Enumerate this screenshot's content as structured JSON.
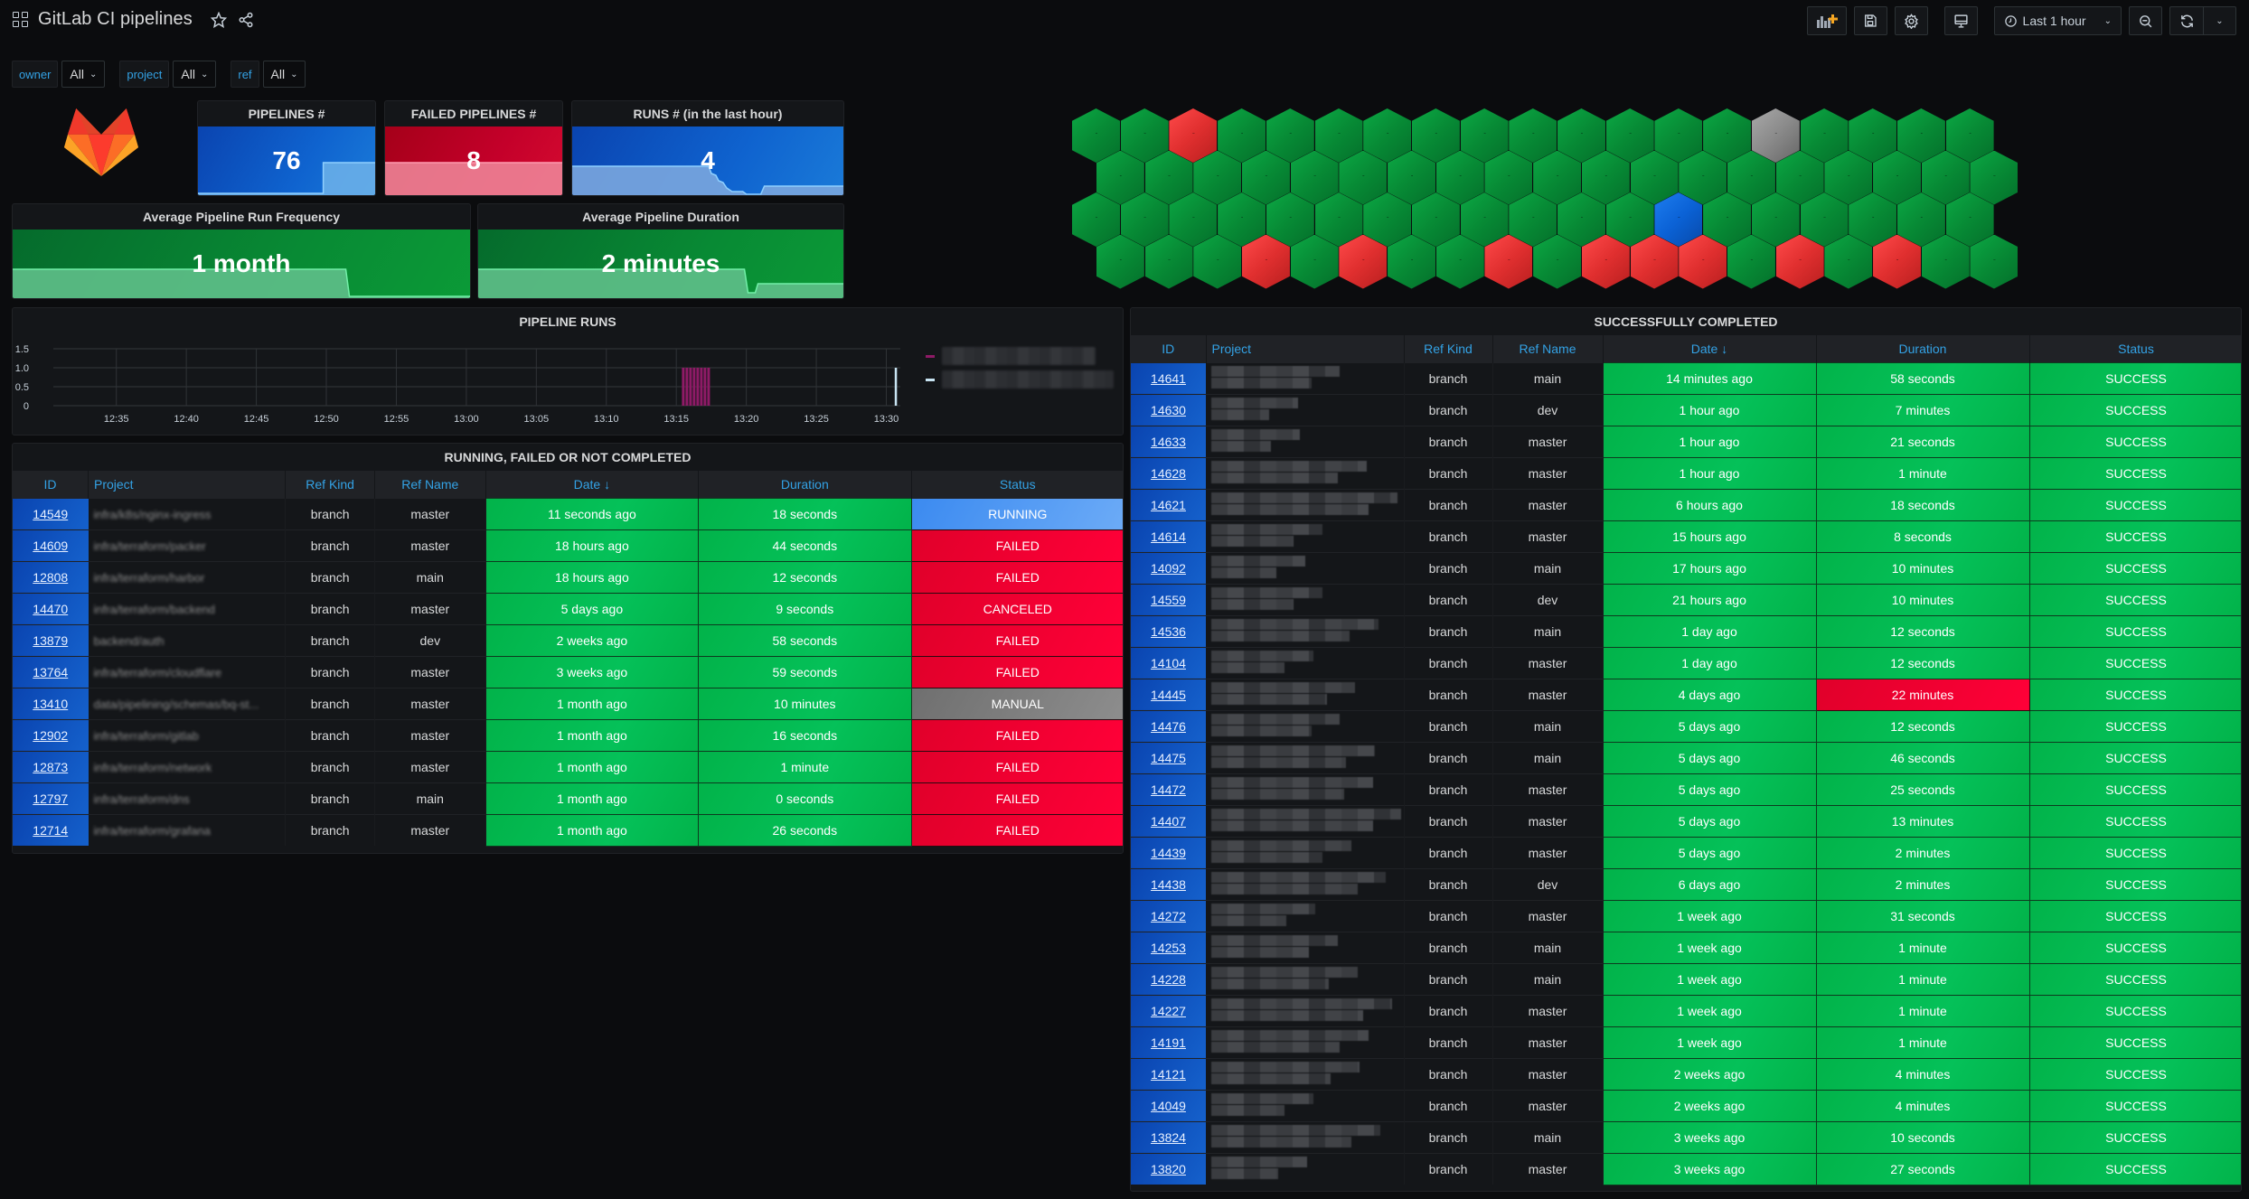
{
  "header": {
    "title": "GitLab CI pipelines",
    "icons": [
      "apps-icon",
      "star-icon",
      "share-icon"
    ],
    "toolbar": {
      "add_panel": "add-panel-icon",
      "save": "save-icon",
      "settings": "gear-icon",
      "tv_mode": "monitor-icon",
      "time_range": "Last 1 hour",
      "zoom_out": "zoom-out-icon",
      "refresh": "refresh-icon"
    }
  },
  "variables": [
    {
      "label": "owner",
      "value": "All"
    },
    {
      "label": "project",
      "value": "All"
    },
    {
      "label": "ref",
      "value": "All"
    }
  ],
  "stats": {
    "pipelines": {
      "title": "PIPELINES #",
      "value": "76"
    },
    "failed": {
      "title": "FAILED PIPELINES #",
      "value": "8"
    },
    "runs": {
      "title": "RUNS # (in the last hour)",
      "value": "4"
    },
    "frequency": {
      "title": "Average Pipeline Run Frequency",
      "value": "1 month"
    },
    "duration": {
      "title": "Average Pipeline Duration",
      "value": "2 minutes"
    }
  },
  "colors": {
    "success": "#05c159",
    "failed": "#ff0038",
    "running": "#3b8af0",
    "manual": "#8d8d8d",
    "accent": "#33a2e5"
  },
  "honeycomb": {
    "rows": [
      [
        "g",
        "g",
        "r",
        "g",
        "g",
        "g",
        "g",
        "g",
        "g",
        "g",
        "g",
        "g",
        "g",
        "g",
        "gr",
        "g",
        "g",
        "g",
        "g"
      ],
      [
        "g",
        "g",
        "g",
        "g",
        "g",
        "g",
        "g",
        "g",
        "g",
        "g",
        "g",
        "g",
        "g",
        "g",
        "g",
        "g",
        "g",
        "g",
        "g"
      ],
      [
        "g",
        "g",
        "g",
        "g",
        "g",
        "g",
        "g",
        "g",
        "g",
        "g",
        "g",
        "g",
        "b",
        "g",
        "g",
        "g",
        "g",
        "g",
        "g"
      ],
      [
        "g",
        "g",
        "g",
        "r",
        "g",
        "r",
        "g",
        "g",
        "r",
        "g",
        "r",
        "r",
        "r",
        "g",
        "r",
        "g",
        "r",
        "g",
        "g"
      ]
    ]
  },
  "pipeline_runs": {
    "title": "PIPELINE RUNS",
    "chart_data": {
      "type": "bar",
      "title": "PIPELINE RUNS",
      "xlabel": "",
      "ylabel": "",
      "x_ticks": [
        "12:35",
        "12:40",
        "12:45",
        "12:50",
        "12:55",
        "13:00",
        "13:05",
        "13:10",
        "13:15",
        "13:20",
        "13:25",
        "13:30"
      ],
      "y_ticks": [
        "0",
        "0.5",
        "1.0",
        "1.5"
      ],
      "ylim": [
        0,
        1.5
      ],
      "grid": true,
      "legend": "right",
      "series": [
        {
          "name": "",
          "color": "#8e1a66",
          "start": "13:15.4",
          "end": "13:17.3",
          "value": 1
        },
        {
          "name": "",
          "color": "#c8e4f2",
          "start": "13:30.6",
          "end": "13:30.6",
          "value": 1
        }
      ]
    }
  },
  "left_table": {
    "title": "RUNNING, FAILED OR NOT COMPLETED",
    "columns": [
      "ID",
      "Project",
      "Ref Kind",
      "Ref Name",
      "Date ↓",
      "Duration",
      "Status"
    ],
    "rows": [
      {
        "id": "14549",
        "project": "infra/k8s/nginx-ingress",
        "ref_kind": "branch",
        "ref_name": "master",
        "date": "11 seconds ago",
        "duration": "18 seconds",
        "status": "RUNNING"
      },
      {
        "id": "14609",
        "project": "infra/terraform/packer",
        "ref_kind": "branch",
        "ref_name": "master",
        "date": "18 hours ago",
        "duration": "44 seconds",
        "status": "FAILED"
      },
      {
        "id": "12808",
        "project": "infra/terraform/harbor",
        "ref_kind": "branch",
        "ref_name": "main",
        "date": "18 hours ago",
        "duration": "12 seconds",
        "status": "FAILED"
      },
      {
        "id": "14470",
        "project": "infra/terraform/backend",
        "ref_kind": "branch",
        "ref_name": "master",
        "date": "5 days ago",
        "duration": "9 seconds",
        "status": "CANCELED"
      },
      {
        "id": "13879",
        "project": "backend/auth",
        "ref_kind": "branch",
        "ref_name": "dev",
        "date": "2 weeks ago",
        "duration": "58 seconds",
        "status": "FAILED"
      },
      {
        "id": "13764",
        "project": "infra/terraform/cloudflare",
        "ref_kind": "branch",
        "ref_name": "master",
        "date": "3 weeks ago",
        "duration": "59 seconds",
        "status": "FAILED"
      },
      {
        "id": "13410",
        "project": "data/pipelining/schemas/bq-st...",
        "ref_kind": "branch",
        "ref_name": "master",
        "date": "1 month ago",
        "duration": "10 minutes",
        "status": "MANUAL"
      },
      {
        "id": "12902",
        "project": "infra/terraform/gitlab",
        "ref_kind": "branch",
        "ref_name": "master",
        "date": "1 month ago",
        "duration": "16 seconds",
        "status": "FAILED"
      },
      {
        "id": "12873",
        "project": "infra/terraform/network",
        "ref_kind": "branch",
        "ref_name": "master",
        "date": "1 month ago",
        "duration": "1 minute",
        "status": "FAILED"
      },
      {
        "id": "12797",
        "project": "infra/terraform/dns",
        "ref_kind": "branch",
        "ref_name": "main",
        "date": "1 month ago",
        "duration": "0 seconds",
        "status": "FAILED"
      },
      {
        "id": "12714",
        "project": "infra/terraform/grafana",
        "ref_kind": "branch",
        "ref_name": "master",
        "date": "1 month ago",
        "duration": "26 seconds",
        "status": "FAILED"
      }
    ]
  },
  "right_table": {
    "title": "SUCCESSFULLY COMPLETED",
    "columns": [
      "ID",
      "Project",
      "Ref Kind",
      "Ref Name",
      "Date ↓",
      "Duration",
      "Status"
    ],
    "rows": [
      {
        "id": "14641",
        "ref_kind": "branch",
        "ref_name": "main",
        "date": "14 minutes ago",
        "duration": "58 seconds",
        "status": "SUCCESS"
      },
      {
        "id": "14630",
        "ref_kind": "branch",
        "ref_name": "dev",
        "date": "1 hour ago",
        "duration": "7 minutes",
        "status": "SUCCESS"
      },
      {
        "id": "14633",
        "ref_kind": "branch",
        "ref_name": "master",
        "date": "1 hour ago",
        "duration": "21 seconds",
        "status": "SUCCESS"
      },
      {
        "id": "14628",
        "ref_kind": "branch",
        "ref_name": "master",
        "date": "1 hour ago",
        "duration": "1 minute",
        "status": "SUCCESS"
      },
      {
        "id": "14621",
        "ref_kind": "branch",
        "ref_name": "master",
        "date": "6 hours ago",
        "duration": "18 seconds",
        "status": "SUCCESS"
      },
      {
        "id": "14614",
        "ref_kind": "branch",
        "ref_name": "master",
        "date": "15 hours ago",
        "duration": "8 seconds",
        "status": "SUCCESS"
      },
      {
        "id": "14092",
        "ref_kind": "branch",
        "ref_name": "main",
        "date": "17 hours ago",
        "duration": "10 minutes",
        "status": "SUCCESS"
      },
      {
        "id": "14559",
        "ref_kind": "branch",
        "ref_name": "dev",
        "date": "21 hours ago",
        "duration": "10 minutes",
        "status": "SUCCESS"
      },
      {
        "id": "14536",
        "ref_kind": "branch",
        "ref_name": "main",
        "date": "1 day ago",
        "duration": "12 seconds",
        "status": "SUCCESS"
      },
      {
        "id": "14104",
        "ref_kind": "branch",
        "ref_name": "master",
        "date": "1 day ago",
        "duration": "12 seconds",
        "status": "SUCCESS"
      },
      {
        "id": "14445",
        "ref_kind": "branch",
        "ref_name": "master",
        "date": "4 days ago",
        "duration": "22 minutes",
        "status": "SUCCESS",
        "duration_alert": true
      },
      {
        "id": "14476",
        "ref_kind": "branch",
        "ref_name": "main",
        "date": "5 days ago",
        "duration": "12 seconds",
        "status": "SUCCESS"
      },
      {
        "id": "14475",
        "ref_kind": "branch",
        "ref_name": "main",
        "date": "5 days ago",
        "duration": "46 seconds",
        "status": "SUCCESS"
      },
      {
        "id": "14472",
        "ref_kind": "branch",
        "ref_name": "master",
        "date": "5 days ago",
        "duration": "25 seconds",
        "status": "SUCCESS"
      },
      {
        "id": "14407",
        "ref_kind": "branch",
        "ref_name": "master",
        "date": "5 days ago",
        "duration": "13 minutes",
        "status": "SUCCESS"
      },
      {
        "id": "14439",
        "ref_kind": "branch",
        "ref_name": "master",
        "date": "5 days ago",
        "duration": "2 minutes",
        "status": "SUCCESS"
      },
      {
        "id": "14438",
        "ref_kind": "branch",
        "ref_name": "dev",
        "date": "6 days ago",
        "duration": "2 minutes",
        "status": "SUCCESS"
      },
      {
        "id": "14272",
        "ref_kind": "branch",
        "ref_name": "master",
        "date": "1 week ago",
        "duration": "31 seconds",
        "status": "SUCCESS"
      },
      {
        "id": "14253",
        "ref_kind": "branch",
        "ref_name": "main",
        "date": "1 week ago",
        "duration": "1 minute",
        "status": "SUCCESS"
      },
      {
        "id": "14228",
        "ref_kind": "branch",
        "ref_name": "main",
        "date": "1 week ago",
        "duration": "1 minute",
        "status": "SUCCESS"
      },
      {
        "id": "14227",
        "ref_kind": "branch",
        "ref_name": "master",
        "date": "1 week ago",
        "duration": "1 minute",
        "status": "SUCCESS"
      },
      {
        "id": "14191",
        "ref_kind": "branch",
        "ref_name": "master",
        "date": "1 week ago",
        "duration": "1 minute",
        "status": "SUCCESS"
      },
      {
        "id": "14121",
        "ref_kind": "branch",
        "ref_name": "master",
        "date": "2 weeks ago",
        "duration": "4 minutes",
        "status": "SUCCESS"
      },
      {
        "id": "14049",
        "ref_kind": "branch",
        "ref_name": "master",
        "date": "2 weeks ago",
        "duration": "4 minutes",
        "status": "SUCCESS"
      },
      {
        "id": "13824",
        "ref_kind": "branch",
        "ref_name": "main",
        "date": "3 weeks ago",
        "duration": "10 seconds",
        "status": "SUCCESS"
      },
      {
        "id": "13820",
        "ref_kind": "branch",
        "ref_name": "master",
        "date": "3 weeks ago",
        "duration": "27 seconds",
        "status": "SUCCESS"
      }
    ]
  }
}
